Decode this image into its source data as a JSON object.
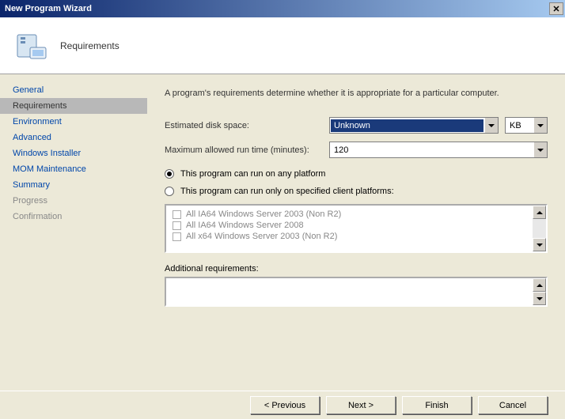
{
  "window": {
    "title": "New Program Wizard"
  },
  "header": {
    "title": "Requirements"
  },
  "nav": {
    "items": [
      {
        "label": "General",
        "state": "link"
      },
      {
        "label": "Requirements",
        "state": "selected"
      },
      {
        "label": "Environment",
        "state": "link"
      },
      {
        "label": "Advanced",
        "state": "link"
      },
      {
        "label": "Windows Installer",
        "state": "link"
      },
      {
        "label": "MOM Maintenance",
        "state": "link"
      },
      {
        "label": "Summary",
        "state": "link"
      },
      {
        "label": "Progress",
        "state": "plain"
      },
      {
        "label": "Confirmation",
        "state": "plain"
      }
    ]
  },
  "content": {
    "description": "A program's requirements determine whether it is appropriate for a particular computer.",
    "disk_space_label": "Estimated disk space:",
    "disk_space_value": "Unknown",
    "disk_space_unit": "KB",
    "runtime_label": "Maximum allowed run time (minutes):",
    "runtime_value": "120",
    "radio_any": "This program can run on any platform",
    "radio_specified": "This program can run only on specified client platforms:",
    "platforms": [
      "All IA64 Windows Server 2003 (Non R2)",
      "All IA64 Windows Server 2008",
      "All x64 Windows Server 2003 (Non R2)"
    ],
    "additional_label": "Additional requirements:",
    "additional_value": ""
  },
  "footer": {
    "previous": "< Previous",
    "next": "Next >",
    "finish": "Finish",
    "cancel": "Cancel"
  }
}
